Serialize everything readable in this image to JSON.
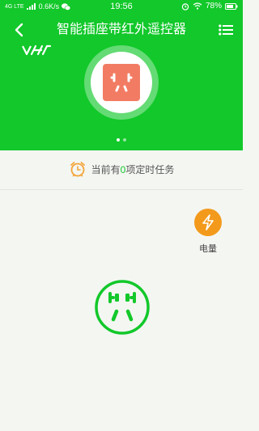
{
  "status_bar": {
    "network": "4G LTE",
    "speed": "0.6K/s",
    "time": "19:56",
    "battery": "78%"
  },
  "header": {
    "title": "智能插座带红外遥控器",
    "back_icon": "chevron-left-icon",
    "menu_icon": "list-menu-icon",
    "brand_logo": "brand-logo-icon"
  },
  "device": {
    "icon": "power-socket-icon",
    "socket_color": "#f27c63",
    "pager_count": 2,
    "pager_active": 1
  },
  "timer": {
    "icon": "alarm-clock-icon",
    "prefix": "当前有",
    "count": "0",
    "suffix": "项定时任务"
  },
  "power": {
    "icon": "lightning-icon",
    "label": "电量",
    "color": "#f39a1c"
  },
  "socket_switch": {
    "icon": "socket-switch-icon",
    "color": "#12c82a"
  },
  "colors": {
    "primary": "#12c82a",
    "background": "#f4f6f2",
    "accent": "#f39a1c"
  }
}
